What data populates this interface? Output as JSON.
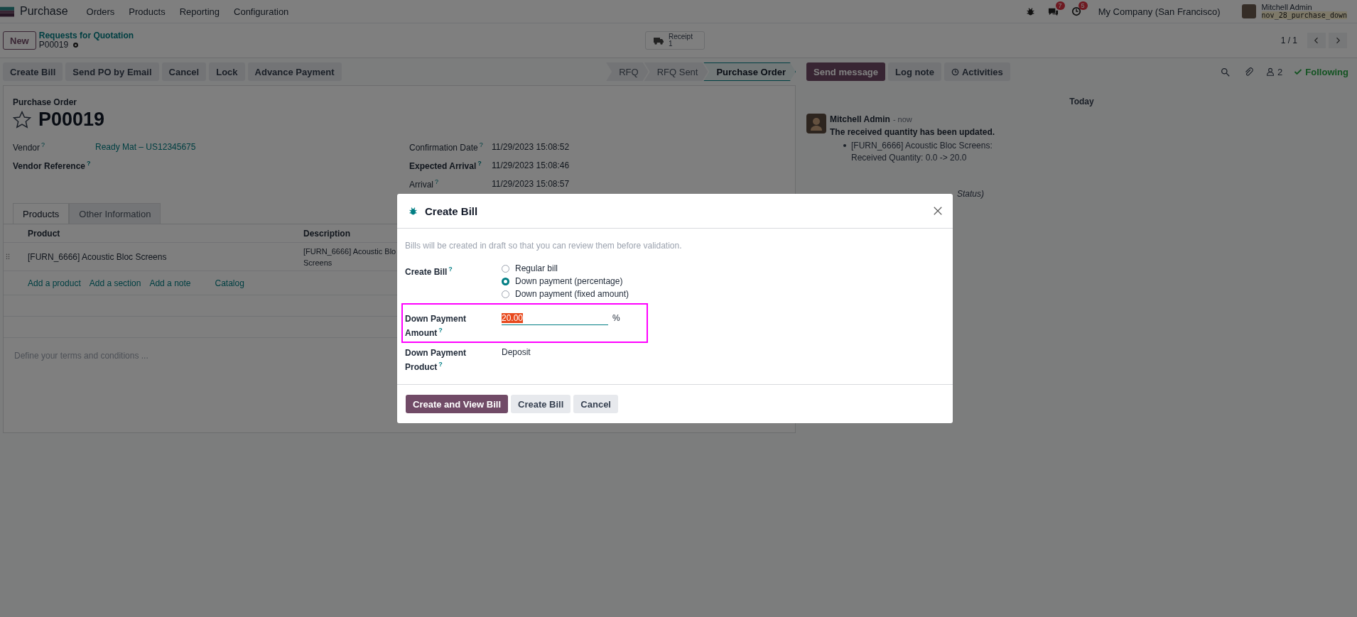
{
  "navbar": {
    "app": "Purchase",
    "menus": [
      "Orders",
      "Products",
      "Reporting",
      "Configuration"
    ],
    "messages_count": "7",
    "activities_count": "5",
    "company": "My Company (San Francisco)",
    "user": "Mitchell Admin",
    "database": "nov_28_purchase_down"
  },
  "breadcrumb": {
    "new_button": "New",
    "parent": "Requests for Quotation",
    "current": "P00019"
  },
  "smart_button": {
    "label": "Receipt",
    "count": "1"
  },
  "pager": {
    "text": "1 / 1"
  },
  "actions": [
    "Create Bill",
    "Send PO by Email",
    "Cancel",
    "Lock",
    "Advance Payment"
  ],
  "statusbar": [
    {
      "label": "RFQ",
      "selected": false
    },
    {
      "label": "RFQ Sent",
      "selected": false
    },
    {
      "label": "Purchase Order",
      "selected": true
    }
  ],
  "form": {
    "subtitle": "Purchase Order",
    "name": "P00019",
    "starred": false,
    "left_fields": [
      {
        "label": "Vendor$^{?}$",
        "bold": false,
        "value": "Ready Mat – US12345675",
        "link": true
      },
      {
        "label": "Vendor Reference$^{?}$",
        "bold": true
      }
    ],
    "right_fields": [
      {
        "label": "Confirmation Date$^{?}$",
        "bold": false,
        "value": "11/29/2023 15:08:52",
        "link": false
      },
      {
        "label": "Expected Arrival$^{?}$",
        "bold": true,
        "value": "11/29/2023 15:08:46",
        "link": false
      },
      {
        "label": "Arrival$^{?}$",
        "bold": false,
        "value": "11/29/2023 15:08:57",
        "link": false
      }
    ],
    "tabs": [
      {
        "label": "Products",
        "selected": true
      },
      {
        "label": "Other Information",
        "selected": false
      }
    ],
    "table": {
      "columns": [
        "Product",
        "Description"
      ],
      "rows": [
        {
          "product": "[FURN_6666] Acoustic Bloc Screens",
          "description": [
            "[FURN_6666] Acoustic Blo",
            "Screens"
          ]
        }
      ]
    },
    "add_links": [
      "Add a product",
      "Add a section",
      "Add a note",
      "Catalog"
    ],
    "terms_placeholder": "Define your terms and conditions ..."
  },
  "chatter": {
    "buttons": [
      {
        "label": "Send message",
        "primary": true
      },
      {
        "label": "Log note",
        "primary": false
      },
      {
        "label": "Activities",
        "primary": false
      }
    ],
    "followers": "2",
    "following": "Following",
    "date": "Today",
    "messages": [
      {
        "author": "Mitchell Admin",
        "time": "- now",
        "title": "The received quantity has been updated.",
        "bullets": [
          "[FURN_6666] Acoustic Bloc Screens: Received Quantity: 0.0 -> 20.0"
        ]
      }
    ],
    "covered_note": "Status)"
  },
  "dialog": {
    "title": "Create Bill",
    "intro": "Bills will be created in draft so that you can review them before validation.",
    "fields": [
      {
        "kind": "radio",
        "label": "Create Bill$^{?}$",
        "options": [
          {
            "label": "Regular bill",
            "selected": false
          },
          {
            "label": "Down payment (percentage)",
            "selected": true
          },
          {
            "label": "Down payment (fixed amount)",
            "selected": false
          }
        ]
      },
      {
        "kind": "input",
        "label": "Down Payment Amount$^{?}$",
        "value": "20.00",
        "value_selected": true,
        "suffix": "%",
        "highlighted": true
      },
      {
        "kind": "text",
        "label": "Down Payment Product$^{?}$",
        "value": "Deposit"
      }
    ],
    "buttons": [
      {
        "label": "Create and View Bill",
        "primary": true
      },
      {
        "label": "Create Bill",
        "primary": false
      },
      {
        "label": "Cancel",
        "primary": false
      }
    ]
  }
}
